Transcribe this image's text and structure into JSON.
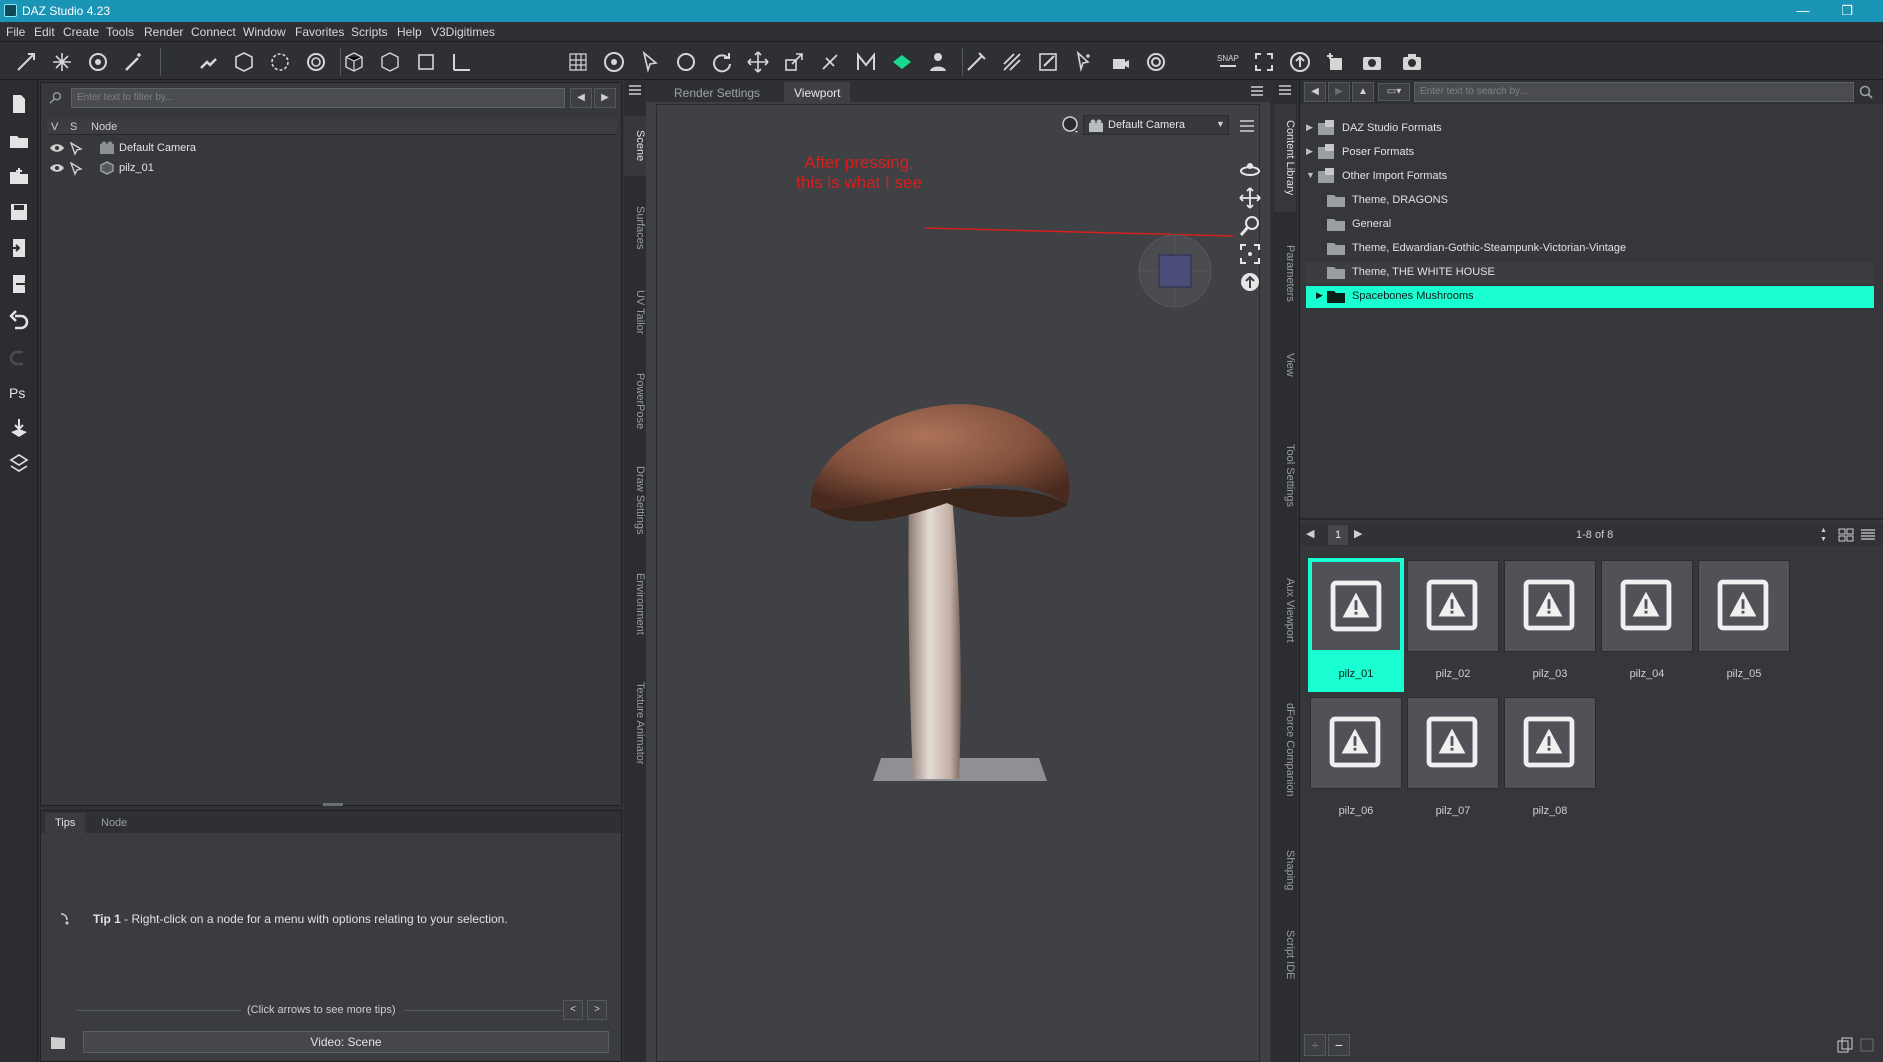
{
  "window": {
    "title": "DAZ Studio 4.23",
    "minimize": "—",
    "maximize": "❐"
  },
  "menubar": [
    "File",
    "Edit",
    "Create",
    "Tools",
    "Render",
    "Connect",
    "Window",
    "Favorites",
    "Scripts",
    "Help",
    "V3Digitimes"
  ],
  "scene": {
    "filter_placeholder": "Enter text to filter by...",
    "columns": {
      "v": "V",
      "s": "S",
      "node": "Node"
    },
    "nodes": [
      "Default Camera",
      "pilz_01"
    ]
  },
  "tips": {
    "tabs": [
      "Tips",
      "Node"
    ],
    "tip_label": "Tip 1",
    "tip_text": " - Right-click on a node for a menu with options relating to your selection.",
    "hint": "(Click arrows to see more tips)",
    "prev": "<",
    "next": ">",
    "video": "Video: Scene"
  },
  "left_vtabs": [
    "Scene",
    "Surfaces",
    "UV Tailor",
    "PowerPose",
    "Draw Settings",
    "Environment",
    "Texture Animator"
  ],
  "viewport": {
    "tabs": [
      "Render Settings",
      "Viewport"
    ],
    "camera": "Default Camera",
    "annotation_line1": "After pressing,",
    "annotation_line2": "this is what I see"
  },
  "right_vtabs": [
    "Content Library",
    "Parameters",
    "View",
    "Tool Settings",
    "Aux Viewport",
    "dForce Companion",
    "Shaping",
    "Script IDE"
  ],
  "content_library": {
    "search_placeholder": "Enter text to search by...",
    "tree": [
      "DAZ Studio Formats",
      "Poser Formats",
      "Other Import Formats",
      "Theme, DRAGONS",
      "General",
      "Theme, Edwardian-Gothic-Steampunk-Victorian-Vintage",
      "Theme, THE WHITE HOUSE",
      "Spacebones Mushrooms"
    ],
    "page": "1",
    "count": "1-8 of 8",
    "items": [
      "pilz_01",
      "pilz_02",
      "pilz_03",
      "pilz_04",
      "pilz_05",
      "pilz_06",
      "pilz_07",
      "pilz_08"
    ],
    "add": "+",
    "remove": "−"
  },
  "colors": {
    "accent": "#19ffd1",
    "titlebar": "#1b95b5",
    "annotation": "#d81e1e"
  }
}
